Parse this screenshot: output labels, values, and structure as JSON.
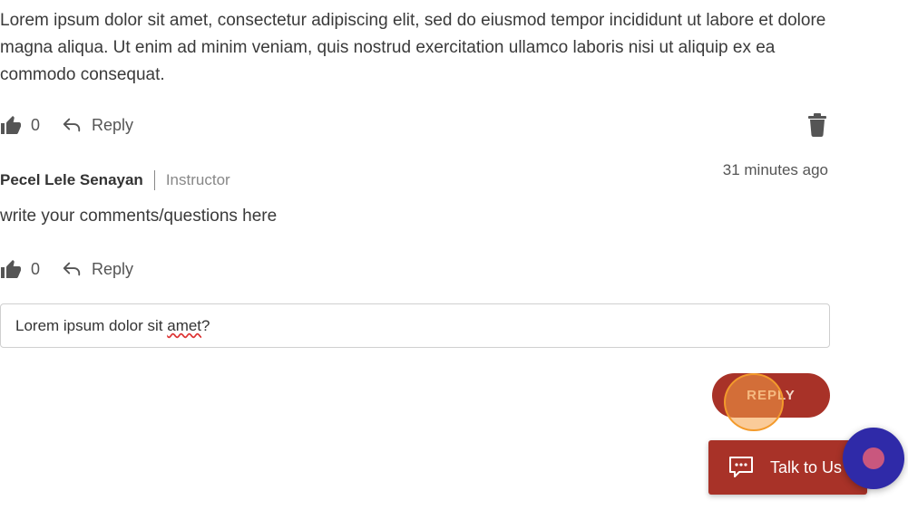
{
  "post": {
    "text": "Lorem ipsum dolor sit amet, consectetur adipiscing elit, sed do eiusmod tempor incididunt ut labore et dolore magna aliqua. Ut enim ad minim veniam, quis nostrud exercitation ullamco laboris nisi ut aliquip ex ea commodo consequat.",
    "like_count": "0",
    "reply_label": "Reply"
  },
  "comment": {
    "author": "Pecel Lele Senayan",
    "role": "Instructor",
    "timestamp": "31 minutes ago",
    "text": "write your comments/questions here",
    "like_count": "0",
    "reply_label": "Reply"
  },
  "reply_form": {
    "value_before": "Lorem ipsum dolor sit ",
    "value_misspelled": "amet",
    "value_after": "?",
    "submit_label": "REPLY"
  },
  "chat_widget": {
    "label": "Talk to Us"
  },
  "icons": {
    "like": "thumbs-up-icon",
    "reply": "reply-arrow-icon",
    "delete": "trash-icon",
    "chat": "chat-bubble-icon"
  },
  "colors": {
    "accent": "#a83228",
    "bot": "#2f2aa8",
    "bot_dot": "#c9577e",
    "icon_gray": "#555555"
  }
}
